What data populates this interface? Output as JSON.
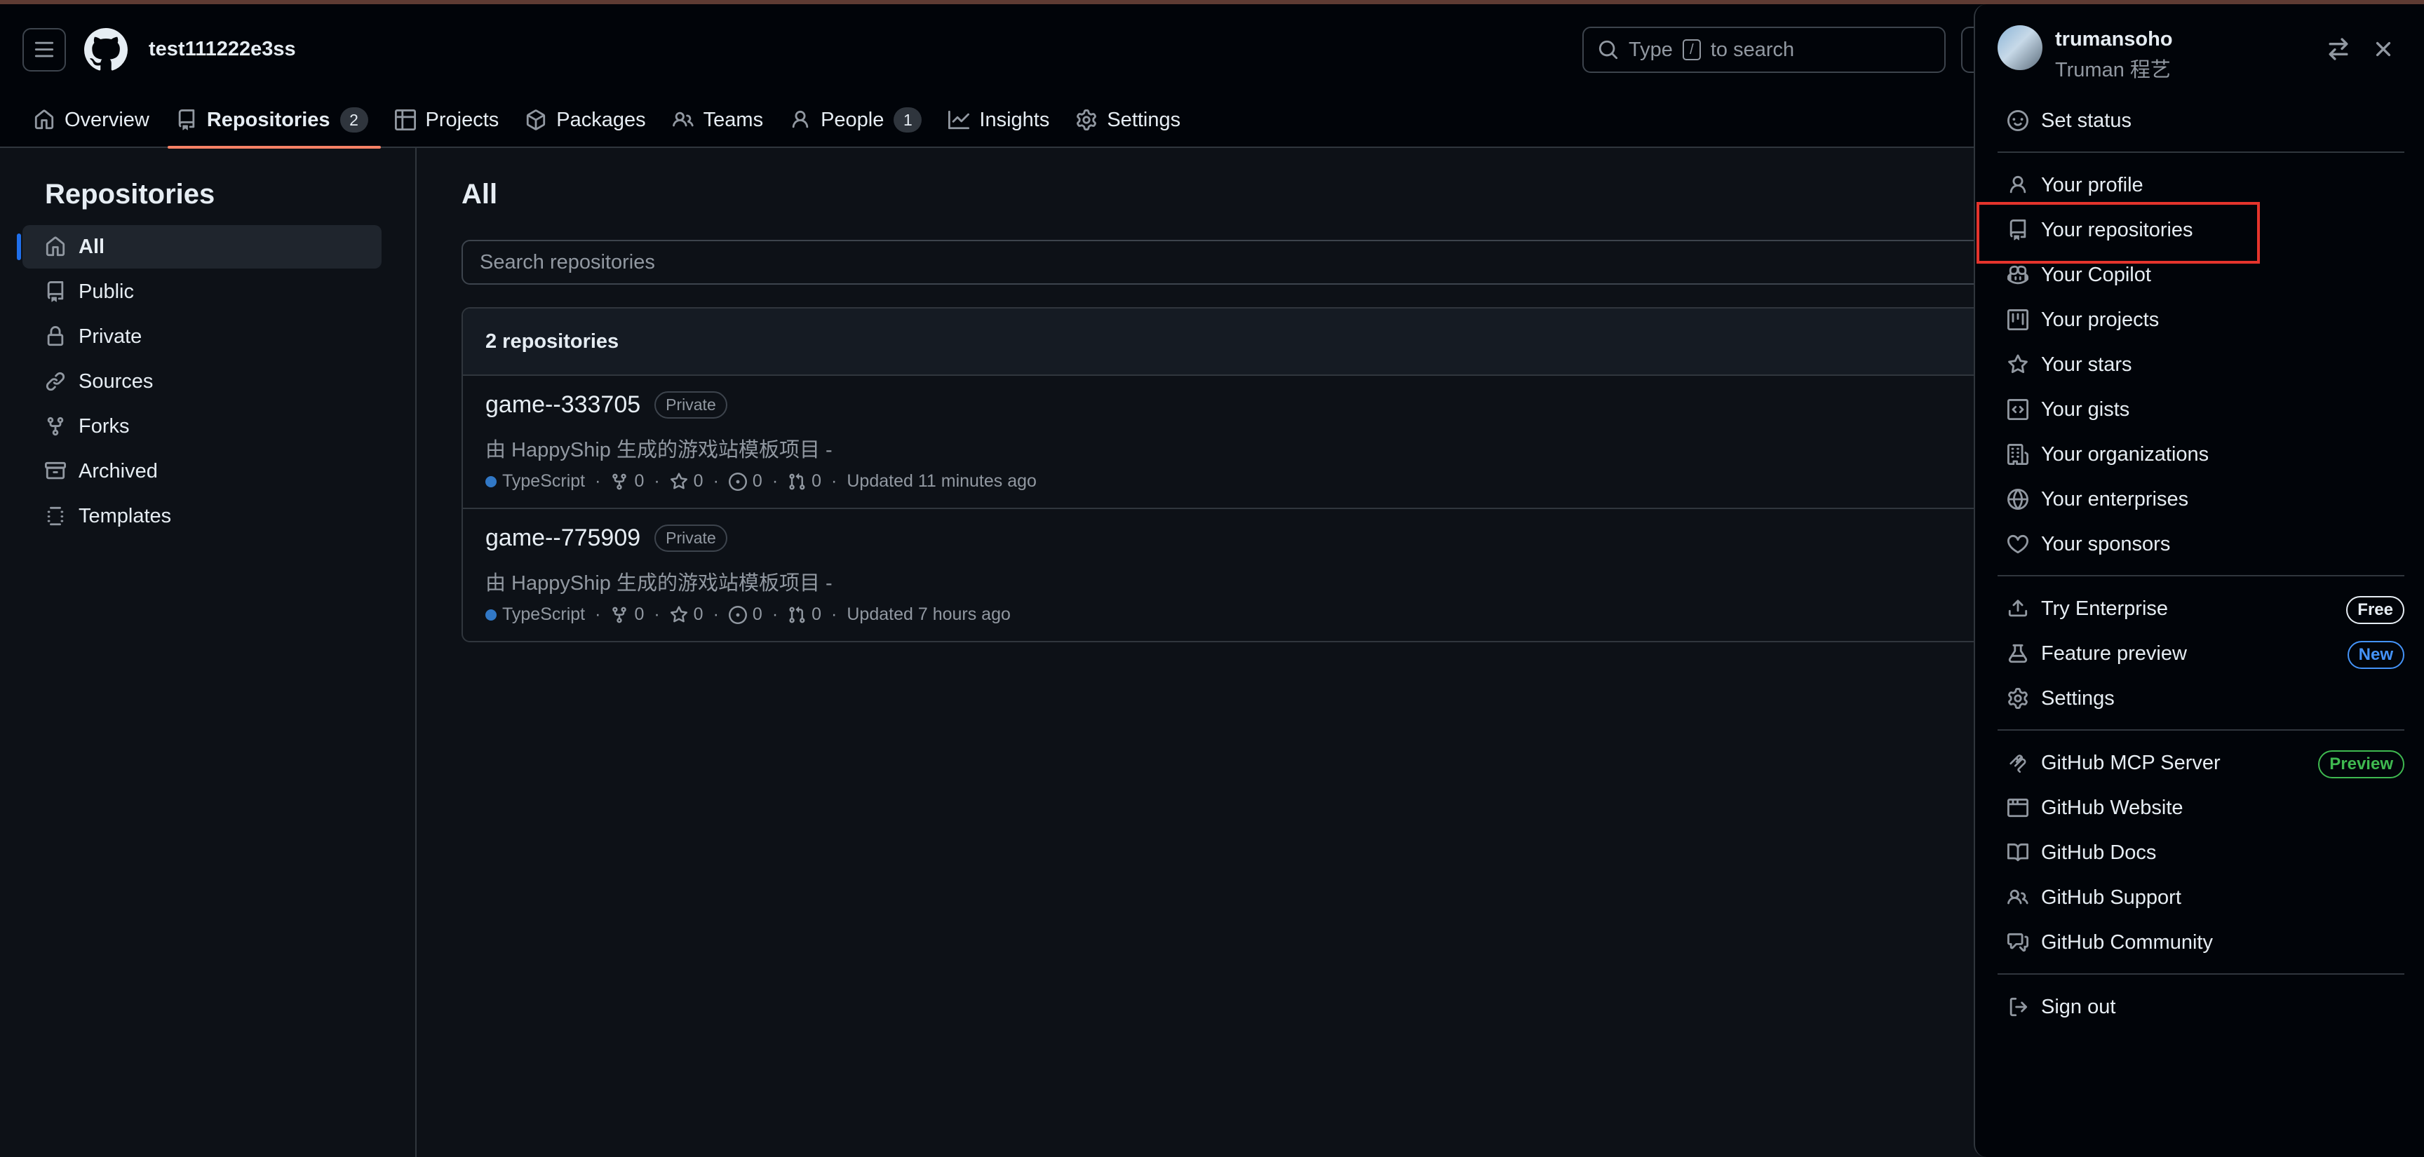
{
  "header": {
    "org_name": "test111222e3ss",
    "search": {
      "prefix": "Type",
      "key": "/",
      "suffix": "to search"
    },
    "nav": [
      {
        "label": "Overview",
        "icon": "home-icon"
      },
      {
        "label": "Repositories",
        "icon": "repo-icon",
        "count": "2",
        "active": true
      },
      {
        "label": "Projects",
        "icon": "table-icon"
      },
      {
        "label": "Packages",
        "icon": "package-icon"
      },
      {
        "label": "Teams",
        "icon": "people-icon"
      },
      {
        "label": "People",
        "icon": "person-icon",
        "count": "1"
      },
      {
        "label": "Insights",
        "icon": "graph-icon"
      },
      {
        "label": "Settings",
        "icon": "gear-icon"
      }
    ]
  },
  "sidebar": {
    "title": "Repositories",
    "items": [
      {
        "label": "All",
        "icon": "home-icon",
        "active": true
      },
      {
        "label": "Public",
        "icon": "repo-icon"
      },
      {
        "label": "Private",
        "icon": "lock-repo-icon"
      },
      {
        "label": "Sources",
        "icon": "link-icon"
      },
      {
        "label": "Forks",
        "icon": "fork-icon"
      },
      {
        "label": "Archived",
        "icon": "archive-icon"
      },
      {
        "label": "Templates",
        "icon": "template-icon"
      }
    ]
  },
  "main": {
    "title": "All",
    "search_placeholder": "Search repositories",
    "list_header": "2 repositories",
    "repos": [
      {
        "name": "game--333705",
        "visibility": "Private",
        "description": "由 HappyShip 生成的游戏站模板项目 -",
        "language": "TypeScript",
        "language_color": "#3178c6",
        "forks": "0",
        "stars": "0",
        "issues": "0",
        "pulls": "0",
        "updated": "Updated 11 minutes ago"
      },
      {
        "name": "game--775909",
        "visibility": "Private",
        "description": "由 HappyShip 生成的游戏站模板项目 -",
        "language": "TypeScript",
        "language_color": "#3178c6",
        "forks": "0",
        "stars": "0",
        "issues": "0",
        "pulls": "0",
        "updated": "Updated 7 hours ago"
      }
    ]
  },
  "user_menu": {
    "login": "trumansoho",
    "full_name": "Truman 程艺",
    "group1": [
      {
        "label": "Set status",
        "icon": "smiley-icon"
      }
    ],
    "group2": [
      {
        "label": "Your profile",
        "icon": "person-icon"
      },
      {
        "label": "Your repositories",
        "icon": "repo-icon"
      },
      {
        "label": "Your Copilot",
        "icon": "copilot-icon"
      },
      {
        "label": "Your projects",
        "icon": "project-icon"
      },
      {
        "label": "Your stars",
        "icon": "star-icon"
      },
      {
        "label": "Your gists",
        "icon": "code-square-icon"
      },
      {
        "label": "Your organizations",
        "icon": "organization-icon"
      },
      {
        "label": "Your enterprises",
        "icon": "globe-icon"
      },
      {
        "label": "Your sponsors",
        "icon": "heart-icon"
      }
    ],
    "group3": [
      {
        "label": "Try Enterprise",
        "icon": "upload-icon",
        "pill": "Free"
      },
      {
        "label": "Feature preview",
        "icon": "beaker-icon",
        "pill": "New"
      },
      {
        "label": "Settings",
        "icon": "gear-icon"
      }
    ],
    "group4": [
      {
        "label": "GitHub MCP Server",
        "icon": "mcp-icon",
        "pill": "Preview"
      },
      {
        "label": "GitHub Website",
        "icon": "browser-icon"
      },
      {
        "label": "GitHub Docs",
        "icon": "book-icon"
      },
      {
        "label": "GitHub Support",
        "icon": "people-icon"
      },
      {
        "label": "GitHub Community",
        "icon": "comment-discussion-icon"
      }
    ],
    "group5": [
      {
        "label": "Sign out",
        "icon": "sign-out-icon"
      }
    ]
  },
  "colors": {
    "accent_underline": "#f78166",
    "highlight": "#e5342c",
    "link_blue": "#4493f8",
    "preview_green": "#3fb950"
  }
}
